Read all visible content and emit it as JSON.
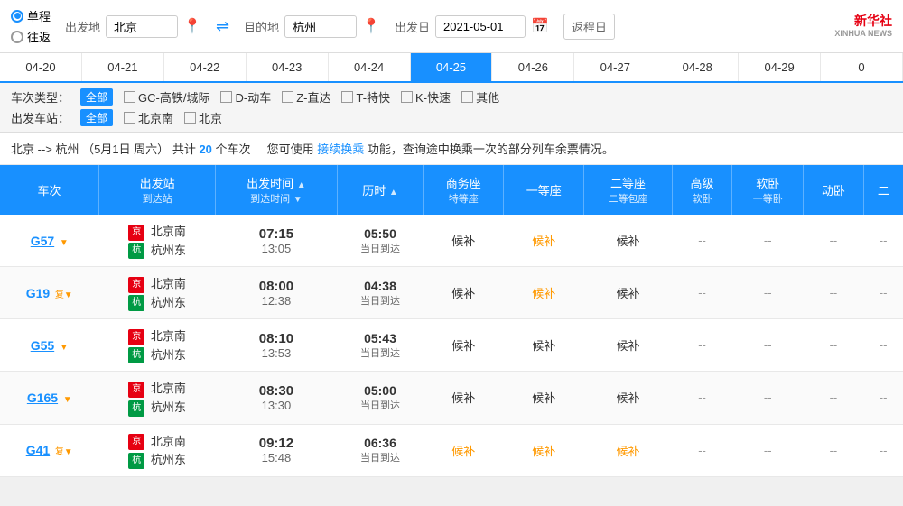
{
  "header": {
    "trip_types": [
      {
        "label": "单程",
        "selected": true
      },
      {
        "label": "往返",
        "selected": false
      }
    ],
    "from_label": "出发地",
    "from_value": "北京",
    "to_label": "目的地",
    "to_value": "杭州",
    "date_label": "出发日",
    "date_value": "2021-05-01",
    "return_label": "返程日",
    "logo_cn": "新华社",
    "logo_en": "XINHUA NEWS"
  },
  "date_tabs": [
    {
      "label": "04-20"
    },
    {
      "label": "04-21"
    },
    {
      "label": "04-22"
    },
    {
      "label": "04-23"
    },
    {
      "label": "04-24"
    },
    {
      "label": "04-25"
    },
    {
      "label": "04-26"
    },
    {
      "label": "04-27"
    },
    {
      "label": "04-28"
    },
    {
      "label": "04-29"
    },
    {
      "label": "0"
    }
  ],
  "filters": {
    "type_label": "车次类型：",
    "type_all": "全部",
    "type_options": [
      {
        "label": "GC-高铁/城际"
      },
      {
        "label": "D-动车"
      },
      {
        "label": "Z-直达"
      },
      {
        "label": "T-特快"
      },
      {
        "label": "K-快速"
      },
      {
        "label": "其他"
      }
    ],
    "station_label": "出发车站：",
    "station_all": "全部",
    "station_options": [
      {
        "label": "北京南"
      },
      {
        "label": "北京"
      }
    ]
  },
  "info_bar": {
    "route": "北京 --> 杭州",
    "date": "（5月1日 周六）",
    "count_text": "共计",
    "count": "20",
    "unit": "个车次",
    "tip_text": "您可使用",
    "tip_link": "接续换乘",
    "tip_suffix": "功能，查询途中换乘一次的部分列车余票情况。"
  },
  "table": {
    "headers": [
      {
        "label": "车次",
        "sub": "",
        "sortable": false
      },
      {
        "label": "出发站",
        "sub": "到达站",
        "sortable": false
      },
      {
        "label": "出发时间",
        "sub": "到达时间",
        "sortable": true,
        "sort": "asc"
      },
      {
        "label": "历时",
        "sub": "",
        "sortable": true
      },
      {
        "label": "商务座",
        "sub": "特等座",
        "sortable": false
      },
      {
        "label": "一等座",
        "sub": "",
        "sortable": false
      },
      {
        "label": "二等座",
        "sub": "二等包座",
        "sortable": false
      },
      {
        "label": "高级",
        "sub": "软卧",
        "sortable": false
      },
      {
        "label": "软卧",
        "sub": "一等卧",
        "sortable": false
      },
      {
        "label": "动卧",
        "sub": "",
        "sortable": false
      },
      {
        "label": "二",
        "sub": "",
        "sortable": false
      }
    ],
    "rows": [
      {
        "train": "G57",
        "has_tag": true,
        "tag": "▼",
        "from_icon": "京",
        "from_station": "北京南",
        "to_icon": "杭",
        "to_station": "杭州东",
        "depart": "07:15",
        "arrive": "13:05",
        "duration": "05:50",
        "same_day": "当日到达",
        "business": "候补",
        "first": "候补",
        "second": "候补",
        "advanced_soft": "--",
        "soft_sleeper": "--",
        "dong_wo": "--",
        "business_color": "normal",
        "first_color": "orange",
        "second_color": "normal",
        "has_fk": false,
        "last": ""
      },
      {
        "train": "G19",
        "has_tag": true,
        "tag": "复▼",
        "from_icon": "京",
        "from_station": "北京南",
        "to_icon": "杭",
        "to_station": "杭州东",
        "depart": "08:00",
        "arrive": "12:38",
        "duration": "04:38",
        "same_day": "当日到达",
        "business": "候补",
        "first": "候补",
        "second": "候补",
        "advanced_soft": "--",
        "soft_sleeper": "--",
        "dong_wo": "--",
        "business_color": "normal",
        "first_color": "orange",
        "second_color": "normal",
        "has_fk": false,
        "last": ""
      },
      {
        "train": "G55",
        "has_tag": true,
        "tag": "▼",
        "from_icon": "京",
        "from_station": "北京南",
        "to_icon": "杭",
        "to_station": "杭州东",
        "depart": "08:10",
        "arrive": "13:53",
        "duration": "05:43",
        "same_day": "当日到达",
        "business": "候补",
        "first": "候补",
        "second": "候补",
        "advanced_soft": "--",
        "soft_sleeper": "--",
        "dong_wo": "--",
        "business_color": "normal",
        "first_color": "normal",
        "second_color": "normal",
        "has_fk": false,
        "last": ""
      },
      {
        "train": "G165",
        "has_tag": true,
        "tag": "▼",
        "from_icon": "京",
        "from_station": "北京南",
        "to_icon": "杭",
        "to_station": "杭州东",
        "depart": "08:30",
        "arrive": "13:30",
        "duration": "05:00",
        "same_day": "当日到达",
        "business": "候补",
        "first": "候补",
        "second": "候补",
        "advanced_soft": "--",
        "soft_sleeper": "--",
        "dong_wo": "--",
        "business_color": "normal",
        "first_color": "normal",
        "second_color": "normal",
        "has_fk": false,
        "last": ""
      },
      {
        "train": "G41",
        "has_tag": true,
        "tag": "复▼",
        "from_icon": "京",
        "from_station": "北京南",
        "to_icon": "杭",
        "to_station": "杭州东",
        "depart": "09:12",
        "arrive": "15:48",
        "duration": "06:36",
        "same_day": "当日到达",
        "business": "候补",
        "first": "候补",
        "second": "候补",
        "advanced_soft": "--",
        "soft_sleeper": "--",
        "dong_wo": "--",
        "business_color": "orange",
        "first_color": "orange",
        "second_color": "orange",
        "has_fk": false,
        "last": ""
      }
    ]
  }
}
